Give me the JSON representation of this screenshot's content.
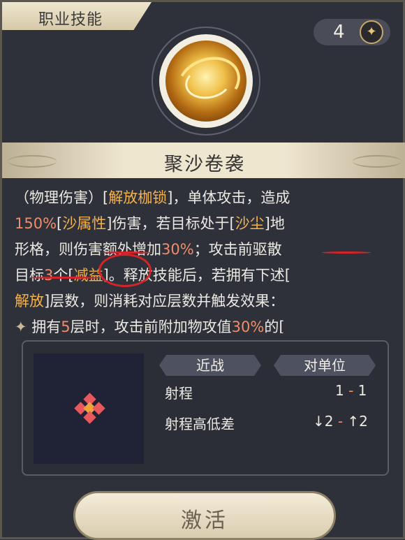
{
  "header": {
    "title": "职业技能"
  },
  "counter": {
    "value": "4",
    "icon": "sparkle-coin-icon"
  },
  "skill": {
    "name": "聚沙卷袭",
    "icon": "sand-swirl-icon"
  },
  "description": {
    "lines": [
      [
        {
          "t": "（物理伤害）[",
          "s": "plain"
        },
        {
          "t": "解放枷锁",
          "s": "hl"
        },
        {
          "t": "]，单体攻击，造成",
          "s": "plain"
        }
      ],
      [
        {
          "t": "150%",
          "s": "num"
        },
        {
          "t": "[",
          "s": "plain"
        },
        {
          "t": "沙属性",
          "s": "hl"
        },
        {
          "t": "]伤害，若目标处于[",
          "s": "plain"
        },
        {
          "t": "沙尘",
          "s": "hl"
        },
        {
          "t": "]地",
          "s": "plain"
        }
      ],
      [
        {
          "t": "形格，则伤害额外增加",
          "s": "plain"
        },
        {
          "t": "30%",
          "s": "num"
        },
        {
          "t": "；攻击前驱散",
          "s": "plain"
        }
      ],
      [
        {
          "t": "目标",
          "s": "plain"
        },
        {
          "t": "3",
          "s": "num"
        },
        {
          "t": "个[",
          "s": "plain"
        },
        {
          "t": "减益",
          "s": "hl"
        },
        {
          "t": "]。释放技能后，若拥有下述[",
          "s": "plain"
        }
      ],
      [
        {
          "t": "解放",
          "s": "hl"
        },
        {
          "t": "]层数，则消耗对应层数并触发效果：",
          "s": "plain"
        }
      ],
      [
        {
          "t": "✦ ",
          "s": "star"
        },
        {
          "t": "拥有",
          "s": "plain"
        },
        {
          "t": "5",
          "s": "num"
        },
        {
          "t": "层时，攻击前附加物攻值",
          "s": "plain"
        },
        {
          "t": "30%",
          "s": "num"
        },
        {
          "t": "的[",
          "s": "plain"
        }
      ]
    ]
  },
  "tags": {
    "attack_type": "近战",
    "target_type": "对单位"
  },
  "stats": {
    "range_label": "射程",
    "range_min": "1",
    "range_max": "1",
    "height_label": "射程高低差",
    "height_down": "↓2",
    "height_up": "↑2",
    "separator": "-"
  },
  "range_grid": {
    "colors": {
      "center": "#f2a23a",
      "adjacent": "#e8595e",
      "background": "#1f2335"
    }
  },
  "activate_button": {
    "label": "激活"
  }
}
